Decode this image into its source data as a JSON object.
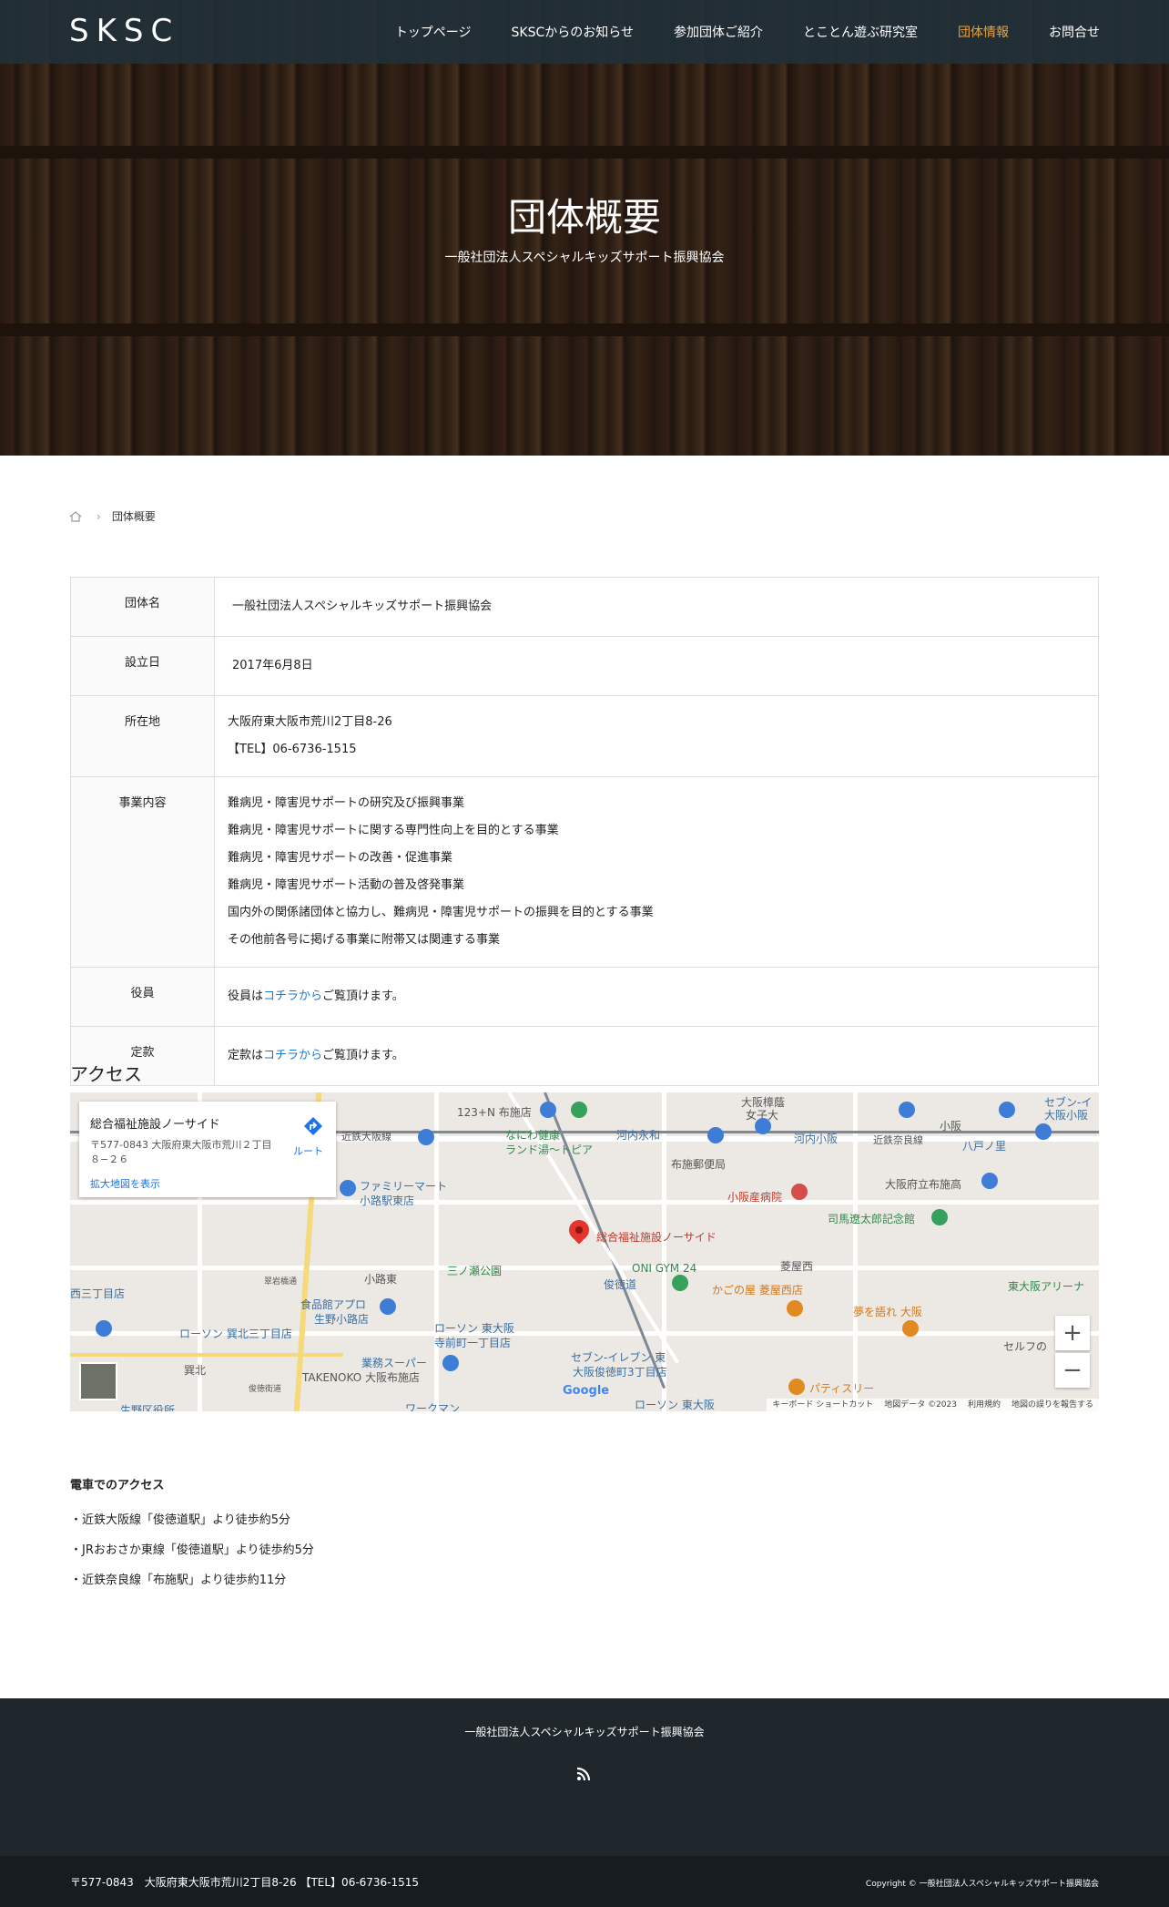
{
  "header": {
    "logo": "SKSC",
    "nav": [
      {
        "label": "トップページ"
      },
      {
        "label": "SKSCからのお知らせ"
      },
      {
        "label": "参加団体ご紹介"
      },
      {
        "label": "とことん遊ぶ研究室"
      },
      {
        "label": "団体情報"
      },
      {
        "label": "お問合せ"
      }
    ],
    "active_color": "#e8a23e"
  },
  "hero": {
    "title": "団体概要",
    "subtitle": "一般社団法人スペシャルキッズサポート振興協会"
  },
  "breadcrumb": {
    "current": "団体概要"
  },
  "table": {
    "rows": [
      {
        "label": "団体名",
        "value": "一般社団法人スペシャルキッズサポート振興協会"
      },
      {
        "label": "設立日",
        "value": "2017年6月8日"
      },
      {
        "label": "所在地",
        "lines": [
          "大阪府東大阪市荒川2丁目8-26",
          "【TEL】06-6736-1515"
        ]
      },
      {
        "label": "事業内容",
        "lines": [
          "難病児・障害児サポートの研究及び振興事業",
          "難病児・障害児サポートに関する専門性向上を目的とする事業",
          "難病児・障害児サポートの改善・促進事業",
          "難病児・障害児サポート活動の普及啓発事業",
          "国内外の関係諸団体と協力し、難病児・障害児サポートの振興を目的とする事業",
          "その他前各号に掲げる事業に附帯又は関連する事業"
        ]
      },
      {
        "label": "役員",
        "prefix": "役員は",
        "link": "コチラから",
        "suffix": "ご覧頂けます。"
      },
      {
        "label": "定款",
        "prefix": "定款は",
        "link": "コチラから",
        "suffix": "ご覧頂けます。"
      }
    ]
  },
  "access": {
    "heading": "アクセス",
    "map": {
      "place_name": "総合福祉施設ノーサイド",
      "address": "〒577-0843 大阪府東大阪市荒川２丁目８−２６",
      "route_label": "ルート",
      "large_map": "拡大地図を表示",
      "google": "Google",
      "attribution": [
        "キーボード ショートカット",
        "地図データ ©2023",
        "利用規約",
        "地図の誤りを報告する"
      ],
      "labels": {
        "a": "123+N 布施店",
        "b": "近鉄大阪線",
        "c": "なにわ健康",
        "d": "ランド湯〜トピア",
        "e": "河内永和",
        "f": "布施郵便局",
        "g": "大阪樟蔭",
        "h": "女子大",
        "i": "河内小阪",
        "j": "近鉄奈良線",
        "k": "小阪",
        "l": "八戸ノ里",
        "m": "セブン-イ",
        "n": "大阪小阪",
        "o": "ファミリーマート",
        "p": "小路駅東店",
        "q": "小阪産病院",
        "r": "大阪府立布施高",
        "s": "司馬遼太郎記念館",
        "t": "総合福祉施設ノーサイド",
        "u": "三ノ瀬公園",
        "v": "小路東",
        "w": "ONI GYM 24",
        "x": "俊徳道",
        "y": "菱屋西",
        "z": "かごの屋 菱屋西店",
        "aa": "東大阪アリーナ",
        "ab": "食品館アプロ",
        "ac": "生野小路店",
        "ad": "ローソン 東大阪",
        "ae": "寺前町一丁目店",
        "af": "夢を語れ 大阪",
        "ag": "セルフの",
        "ah": "西三丁目店",
        "ai": "ローソン 巽北三丁目店",
        "aj": "巽北",
        "ak": "業務スーパー",
        "al": "TAKENOKO 大阪布施店",
        "am": "セブン-イレブン 東",
        "an": "大阪俊徳町3丁目店",
        "ao": "パティスリー",
        "ap": "ローソン 東大阪",
        "aq": "ワークマン",
        "ar": "生野区役所",
        "as": "翠岩橋通",
        "at": "俊徳街道"
      }
    }
  },
  "train": {
    "heading": "電車でのアクセス",
    "lines": [
      "・近鉄大阪線「俊徳道駅」より徒歩約5分",
      "・JRおおさか東線「俊徳道駅」より徒歩約5分",
      "・近鉄奈良線「布施駅」より徒歩約11分"
    ]
  },
  "footer": {
    "org": "一般社団法人スペシャルキッズサポート振興協会",
    "address": "〒577-0843　大阪府東大阪市荒川2丁目8-26 【TEL】06-6736-1515",
    "copyright": "Copyright © 一般社団法人スペシャルキッズサポート振興協会"
  }
}
